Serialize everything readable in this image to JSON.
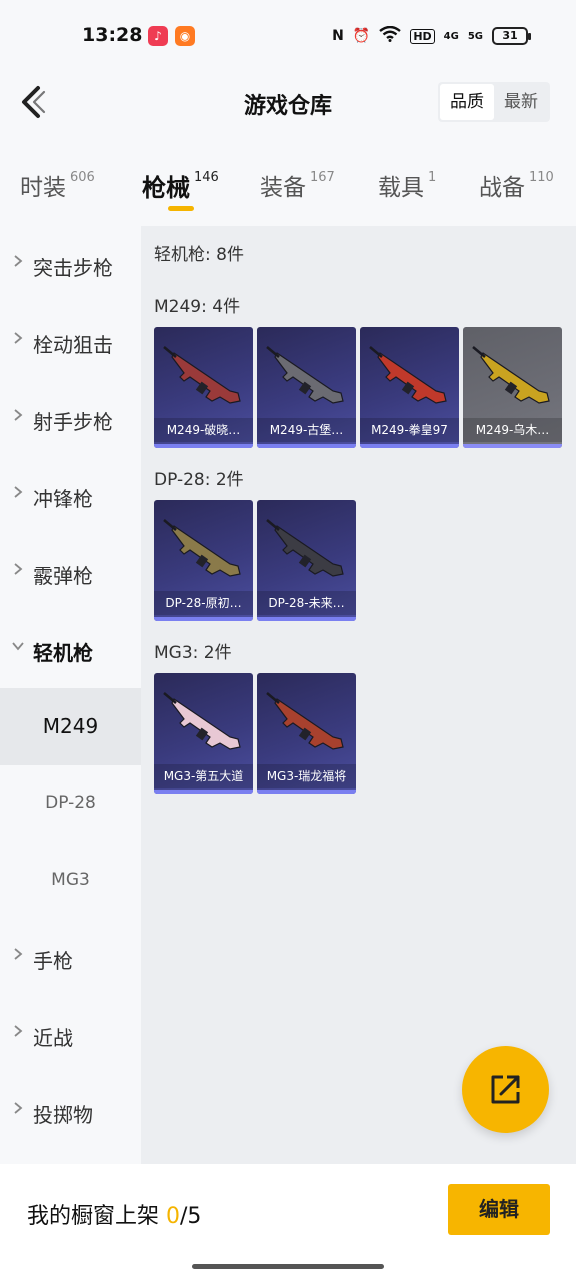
{
  "status_bar": {
    "time": "13:28",
    "nfc": "N",
    "hd_label": "HD",
    "net_4g": "4G",
    "net_5g": "5G",
    "battery": "31"
  },
  "header": {
    "title": "游戏仓库",
    "sort_options": [
      "品质",
      "最新"
    ],
    "sort_active": "品质"
  },
  "tabs": [
    {
      "label": "时装",
      "count": "606"
    },
    {
      "label": "枪械",
      "count": "146",
      "active": true
    },
    {
      "label": "装备",
      "count": "167"
    },
    {
      "label": "载具",
      "count": "1"
    },
    {
      "label": "战备",
      "count": "110"
    }
  ],
  "sidebar": {
    "categories": [
      {
        "label": "突击步枪"
      },
      {
        "label": "栓动狙击"
      },
      {
        "label": "射手步枪"
      },
      {
        "label": "冲锋枪"
      },
      {
        "label": "霰弹枪"
      },
      {
        "label": "轻机枪",
        "open": true
      },
      {
        "label": "手枪"
      },
      {
        "label": "近战"
      },
      {
        "label": "投掷物"
      }
    ],
    "subitems": [
      {
        "label": "M249",
        "active": true
      },
      {
        "label": "DP-28"
      },
      {
        "label": "MG3"
      }
    ]
  },
  "content": {
    "summary": "轻机枪: 8件",
    "groups": [
      {
        "title": "M249: 4件",
        "items": [
          {
            "label": "M249-破晓…",
            "gun_color": "#9a3a3a"
          },
          {
            "label": "M249-古堡…",
            "gun_color": "#6b6b72"
          },
          {
            "label": "M249-拳皇97",
            "gun_color": "#c0392b"
          },
          {
            "label": "M249-乌木…",
            "gun_color": "#c9a320",
            "gray": true
          }
        ]
      },
      {
        "title": "DP-28: 2件",
        "items": [
          {
            "label": "DP-28-原初…",
            "gun_color": "#8a7a4a"
          },
          {
            "label": "DP-28-未来…",
            "gun_color": "#3c3c44"
          }
        ]
      },
      {
        "title": "MG3: 2件",
        "items": [
          {
            "label": "MG3-第五大道",
            "gun_color": "#e8c8d4"
          },
          {
            "label": "MG3-瑞龙福将",
            "gun_color": "#a8412e"
          }
        ]
      }
    ]
  },
  "bottom": {
    "showcase_prefix": "我的橱窗上架 ",
    "showcase_current": "0",
    "showcase_total": "/5",
    "edit_label": "编辑"
  },
  "colors": {
    "accent": "#f7b500",
    "card_bg": "#3a3b7e"
  }
}
